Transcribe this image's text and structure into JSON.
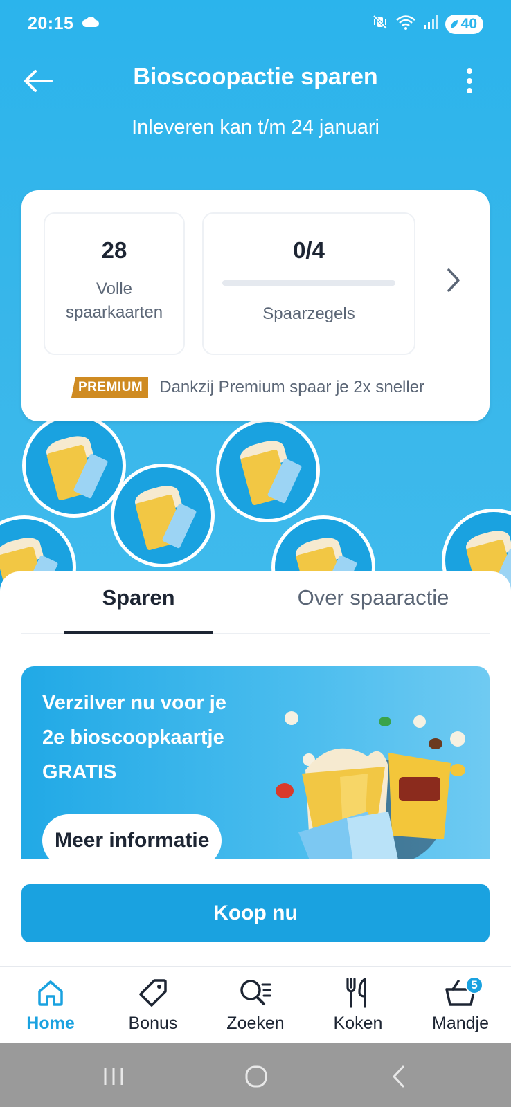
{
  "status_bar": {
    "time": "20:15",
    "battery": "40"
  },
  "header": {
    "title": "Bioscoopactie sparen",
    "subtitle": "Inleveren kan t/m 24 januari"
  },
  "stats": {
    "full_cards_value": "28",
    "full_cards_label_line1": "Volle",
    "full_cards_label_line2": "spaarkaarten",
    "stamps_value": "0/4",
    "stamps_progress": 0,
    "stamps_label": "Spaarzegels",
    "premium_badge": "PREMIUM",
    "premium_text": "Dankzij Premium spaar je 2x sneller"
  },
  "tabs": [
    {
      "label": "Sparen",
      "active": true
    },
    {
      "label": "Over spaaractie",
      "active": false
    }
  ],
  "promo": {
    "line1": "Verzilver nu voor je",
    "line2": "2e bioscoopkaartje",
    "line3": "GRATIS",
    "button": "Meer informatie"
  },
  "buy_button": "Koop nu",
  "nav": {
    "items": [
      {
        "label": "Home",
        "icon": "home-icon",
        "active": true
      },
      {
        "label": "Bonus",
        "icon": "tag-icon"
      },
      {
        "label": "Zoeken",
        "icon": "search-list-icon"
      },
      {
        "label": "Koken",
        "icon": "cutlery-icon"
      },
      {
        "label": "Mandje",
        "icon": "basket-icon",
        "badge": "5"
      }
    ]
  },
  "colors": {
    "brand_blue": "#1aa2e0",
    "hero_blue": "#2bb4ec",
    "premium_orange": "#cf8b22",
    "text_dark": "#1d2533"
  }
}
